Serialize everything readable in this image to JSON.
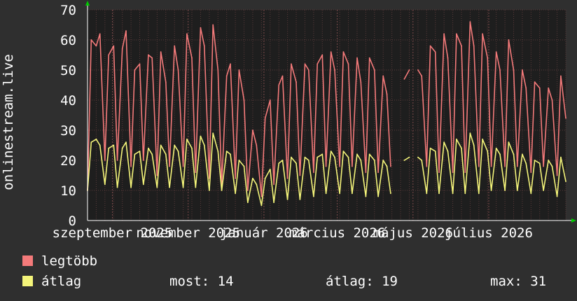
{
  "chart_data": {
    "type": "line",
    "ylabel": "onlinestream.live",
    "ylim": [
      0,
      70
    ],
    "y_ticks": [
      0,
      10,
      20,
      30,
      40,
      50,
      60,
      70
    ],
    "x_range": [
      "2025-08-12",
      "2026-09-01"
    ],
    "x_ticks": [
      {
        "date": "2025-09-01",
        "label": "szeptember 2025"
      },
      {
        "date": "2025-11-01",
        "label": "november 2025"
      },
      {
        "date": "2026-01-01",
        "label": "január 2026"
      },
      {
        "date": "2026-03-01",
        "label": "március 2026"
      },
      {
        "date": "2026-05-01",
        "label": "május 2026"
      },
      {
        "date": "2026-07-01",
        "label": "július 2026"
      }
    ],
    "grid": true,
    "legend_position": "bottom-left",
    "colors": {
      "background": "#2f2f2f",
      "plot": "#1e1e1e",
      "grid": "#5a3a3a",
      "max": "#f47a7a",
      "avg": "#f4f47a",
      "axis": "#ffffff",
      "arrow": "#00cc00"
    },
    "series": [
      {
        "name": "legtöbb",
        "color": "#f47a7a",
        "points": [
          [
            "2025-08-12",
            10
          ],
          [
            "2025-08-15",
            60
          ],
          [
            "2025-08-19",
            58
          ],
          [
            "2025-08-22",
            62
          ],
          [
            "2025-08-26",
            20
          ],
          [
            "2025-08-29",
            55
          ],
          [
            "2025-09-02",
            58
          ],
          [
            "2025-09-05",
            20
          ],
          [
            "2025-09-09",
            57
          ],
          [
            "2025-09-12",
            63
          ],
          [
            "2025-09-16",
            18
          ],
          [
            "2025-09-19",
            50
          ],
          [
            "2025-09-23",
            52
          ],
          [
            "2025-09-26",
            20
          ],
          [
            "2025-09-30",
            55
          ],
          [
            "2025-10-03",
            54
          ],
          [
            "2025-10-07",
            15
          ],
          [
            "2025-10-10",
            56
          ],
          [
            "2025-10-14",
            46
          ],
          [
            "2025-10-17",
            18
          ],
          [
            "2025-10-21",
            58
          ],
          [
            "2025-10-24",
            50
          ],
          [
            "2025-10-28",
            18
          ],
          [
            "2025-10-31",
            62
          ],
          [
            "2025-11-04",
            54
          ],
          [
            "2025-11-07",
            16
          ],
          [
            "2025-11-11",
            64
          ],
          [
            "2025-11-14",
            58
          ],
          [
            "2025-11-18",
            14
          ],
          [
            "2025-11-21",
            65
          ],
          [
            "2025-11-25",
            50
          ],
          [
            "2025-11-28",
            12
          ],
          [
            "2025-12-02",
            48
          ],
          [
            "2025-12-05",
            52
          ],
          [
            "2025-12-09",
            14
          ],
          [
            "2025-12-12",
            50
          ],
          [
            "2025-12-16",
            40
          ],
          [
            "2025-12-19",
            10
          ],
          [
            "2025-12-23",
            30
          ],
          [
            "2025-12-26",
            25
          ],
          [
            "2025-12-30",
            8
          ],
          [
            "2026-01-02",
            34
          ],
          [
            "2026-01-06",
            40
          ],
          [
            "2026-01-09",
            12
          ],
          [
            "2026-01-13",
            45
          ],
          [
            "2026-01-16",
            48
          ],
          [
            "2026-01-20",
            14
          ],
          [
            "2026-01-23",
            52
          ],
          [
            "2026-01-27",
            46
          ],
          [
            "2026-01-30",
            15
          ],
          [
            "2026-02-03",
            52
          ],
          [
            "2026-02-06",
            50
          ],
          [
            "2026-02-10",
            16
          ],
          [
            "2026-02-13",
            52
          ],
          [
            "2026-02-17",
            55
          ],
          [
            "2026-02-20",
            18
          ],
          [
            "2026-02-24",
            56
          ],
          [
            "2026-02-27",
            50
          ],
          [
            "2026-03-03",
            18
          ],
          [
            "2026-03-06",
            56
          ],
          [
            "2026-03-10",
            52
          ],
          [
            "2026-03-13",
            18
          ],
          [
            "2026-03-17",
            54
          ],
          [
            "2026-03-20",
            46
          ],
          [
            "2026-03-24",
            16
          ],
          [
            "2026-03-27",
            54
          ],
          [
            "2026-03-31",
            50
          ],
          [
            "2026-04-03",
            16
          ],
          [
            "2026-04-07",
            48
          ],
          [
            "2026-04-10",
            42
          ],
          [
            "2026-04-13",
            18
          ],
          [
            "2026-04-17",
            null
          ],
          [
            "2026-04-21",
            null
          ],
          [
            "2026-04-24",
            47
          ],
          [
            "2026-04-28",
            50
          ],
          [
            "2026-05-01",
            null
          ],
          [
            "2026-05-05",
            50
          ],
          [
            "2026-05-08",
            48
          ],
          [
            "2026-05-12",
            18
          ],
          [
            "2026-05-15",
            58
          ],
          [
            "2026-05-19",
            56
          ],
          [
            "2026-05-22",
            16
          ],
          [
            "2026-05-26",
            62
          ],
          [
            "2026-05-29",
            54
          ],
          [
            "2026-06-02",
            16
          ],
          [
            "2026-06-05",
            62
          ],
          [
            "2026-06-09",
            58
          ],
          [
            "2026-06-12",
            16
          ],
          [
            "2026-06-16",
            66
          ],
          [
            "2026-06-19",
            58
          ],
          [
            "2026-06-23",
            18
          ],
          [
            "2026-06-26",
            62
          ],
          [
            "2026-06-30",
            54
          ],
          [
            "2026-07-03",
            18
          ],
          [
            "2026-07-07",
            56
          ],
          [
            "2026-07-10",
            50
          ],
          [
            "2026-07-14",
            18
          ],
          [
            "2026-07-17",
            60
          ],
          [
            "2026-07-21",
            50
          ],
          [
            "2026-07-24",
            18
          ],
          [
            "2026-07-28",
            50
          ],
          [
            "2026-07-31",
            44
          ],
          [
            "2026-08-04",
            16
          ],
          [
            "2026-08-07",
            46
          ],
          [
            "2026-08-11",
            44
          ],
          [
            "2026-08-14",
            18
          ],
          [
            "2026-08-18",
            44
          ],
          [
            "2026-08-21",
            40
          ],
          [
            "2026-08-25",
            15
          ],
          [
            "2026-08-28",
            48
          ],
          [
            "2026-09-01",
            34
          ]
        ]
      },
      {
        "name": "átlag",
        "color": "#f4f47a",
        "points": [
          [
            "2025-08-12",
            10
          ],
          [
            "2025-08-15",
            26
          ],
          [
            "2025-08-19",
            27
          ],
          [
            "2025-08-22",
            25
          ],
          [
            "2025-08-26",
            12
          ],
          [
            "2025-08-29",
            24
          ],
          [
            "2025-09-02",
            25
          ],
          [
            "2025-09-05",
            11
          ],
          [
            "2025-09-09",
            24
          ],
          [
            "2025-09-12",
            26
          ],
          [
            "2025-09-16",
            11
          ],
          [
            "2025-09-19",
            22
          ],
          [
            "2025-09-23",
            23
          ],
          [
            "2025-09-26",
            12
          ],
          [
            "2025-09-30",
            24
          ],
          [
            "2025-10-03",
            22
          ],
          [
            "2025-10-07",
            11
          ],
          [
            "2025-10-10",
            25
          ],
          [
            "2025-10-14",
            22
          ],
          [
            "2025-10-17",
            11
          ],
          [
            "2025-10-21",
            25
          ],
          [
            "2025-10-24",
            23
          ],
          [
            "2025-10-28",
            11
          ],
          [
            "2025-10-31",
            27
          ],
          [
            "2025-11-04",
            24
          ],
          [
            "2025-11-07",
            11
          ],
          [
            "2025-11-11",
            28
          ],
          [
            "2025-11-14",
            25
          ],
          [
            "2025-11-18",
            10
          ],
          [
            "2025-11-21",
            29
          ],
          [
            "2025-11-25",
            23
          ],
          [
            "2025-11-28",
            10
          ],
          [
            "2025-12-02",
            23
          ],
          [
            "2025-12-05",
            22
          ],
          [
            "2025-12-09",
            9
          ],
          [
            "2025-12-12",
            20
          ],
          [
            "2025-12-16",
            18
          ],
          [
            "2025-12-19",
            6
          ],
          [
            "2025-12-23",
            14
          ],
          [
            "2025-12-26",
            12
          ],
          [
            "2025-12-30",
            5
          ],
          [
            "2026-01-02",
            14
          ],
          [
            "2026-01-06",
            17
          ],
          [
            "2026-01-09",
            6
          ],
          [
            "2026-01-13",
            19
          ],
          [
            "2026-01-16",
            20
          ],
          [
            "2026-01-20",
            7
          ],
          [
            "2026-01-23",
            21
          ],
          [
            "2026-01-27",
            19
          ],
          [
            "2026-01-30",
            7
          ],
          [
            "2026-02-03",
            21
          ],
          [
            "2026-02-06",
            20
          ],
          [
            "2026-02-10",
            8
          ],
          [
            "2026-02-13",
            21
          ],
          [
            "2026-02-17",
            22
          ],
          [
            "2026-02-20",
            9
          ],
          [
            "2026-02-24",
            23
          ],
          [
            "2026-02-27",
            21
          ],
          [
            "2026-03-03",
            9
          ],
          [
            "2026-03-06",
            23
          ],
          [
            "2026-03-10",
            21
          ],
          [
            "2026-03-13",
            9
          ],
          [
            "2026-03-17",
            22
          ],
          [
            "2026-03-20",
            20
          ],
          [
            "2026-03-24",
            8
          ],
          [
            "2026-03-27",
            22
          ],
          [
            "2026-03-31",
            20
          ],
          [
            "2026-04-03",
            8
          ],
          [
            "2026-04-07",
            20
          ],
          [
            "2026-04-10",
            18
          ],
          [
            "2026-04-13",
            9
          ],
          [
            "2026-04-17",
            null
          ],
          [
            "2026-04-21",
            null
          ],
          [
            "2026-04-24",
            20
          ],
          [
            "2026-04-28",
            21
          ],
          [
            "2026-05-01",
            null
          ],
          [
            "2026-05-05",
            21
          ],
          [
            "2026-05-08",
            20
          ],
          [
            "2026-05-12",
            9
          ],
          [
            "2026-05-15",
            24
          ],
          [
            "2026-05-19",
            23
          ],
          [
            "2026-05-22",
            9
          ],
          [
            "2026-05-26",
            26
          ],
          [
            "2026-05-29",
            23
          ],
          [
            "2026-06-02",
            9
          ],
          [
            "2026-06-05",
            27
          ],
          [
            "2026-06-09",
            24
          ],
          [
            "2026-06-12",
            9
          ],
          [
            "2026-06-16",
            29
          ],
          [
            "2026-06-19",
            25
          ],
          [
            "2026-06-23",
            9
          ],
          [
            "2026-06-26",
            27
          ],
          [
            "2026-06-30",
            23
          ],
          [
            "2026-07-03",
            10
          ],
          [
            "2026-07-07",
            24
          ],
          [
            "2026-07-10",
            22
          ],
          [
            "2026-07-14",
            10
          ],
          [
            "2026-07-17",
            26
          ],
          [
            "2026-07-21",
            22
          ],
          [
            "2026-07-24",
            10
          ],
          [
            "2026-07-28",
            22
          ],
          [
            "2026-07-31",
            19
          ],
          [
            "2026-08-04",
            9
          ],
          [
            "2026-08-07",
            20
          ],
          [
            "2026-08-11",
            19
          ],
          [
            "2026-08-14",
            10
          ],
          [
            "2026-08-18",
            20
          ],
          [
            "2026-08-21",
            18
          ],
          [
            "2026-08-25",
            8
          ],
          [
            "2026-08-28",
            21
          ],
          [
            "2026-09-01",
            13
          ]
        ]
      }
    ]
  },
  "legend": {
    "max_label": "legtöbb",
    "avg_label": "átlag",
    "now_label": "most:",
    "now_value": "14",
    "avg_stat_label": "átlag:",
    "avg_stat_value": "19",
    "max_stat_label": "max:",
    "max_stat_value": "31"
  }
}
